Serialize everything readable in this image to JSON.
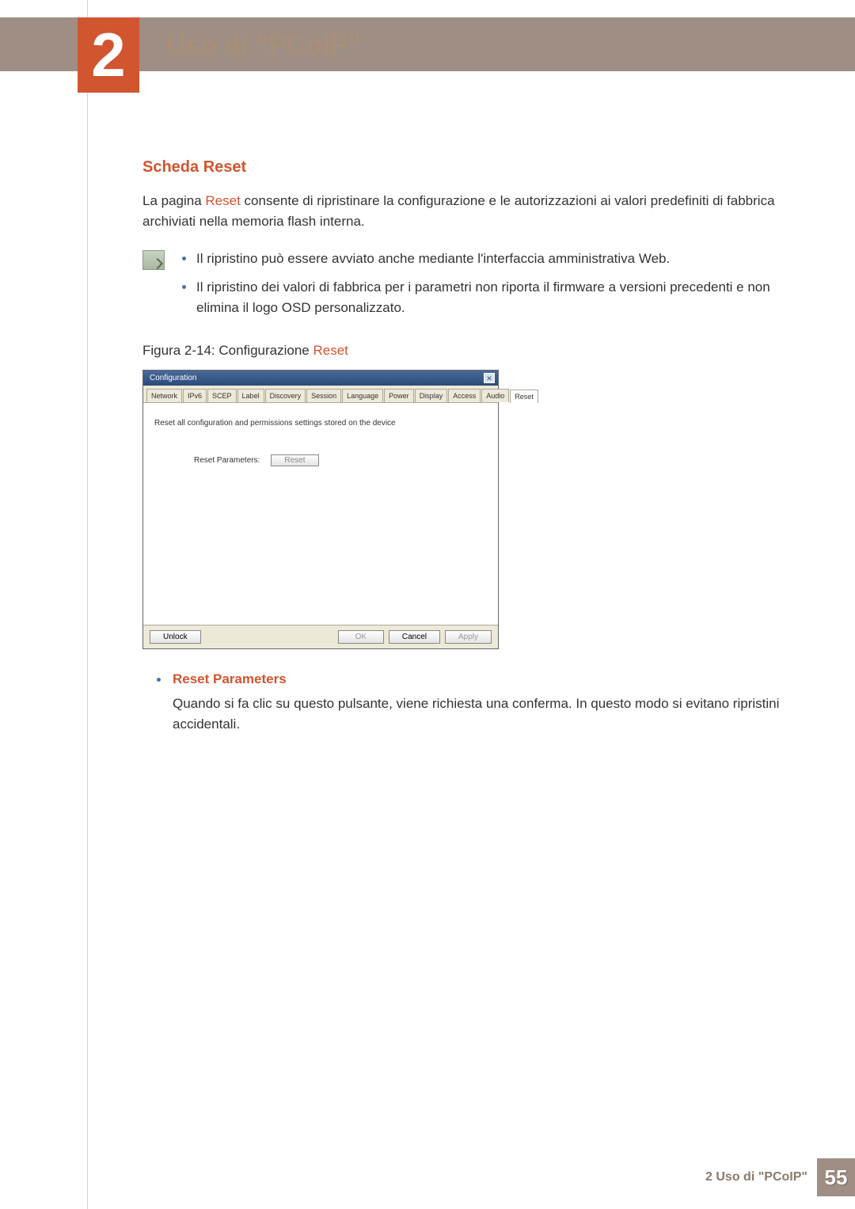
{
  "header": {
    "chapter_number": "2",
    "chapter_title": "Uso di \"PCoIP\""
  },
  "section": {
    "heading": "Scheda Reset",
    "para_prefix": "La pagina ",
    "para_key": "Reset",
    "para_suffix": " consente di ripristinare la configurazione e le autorizzazioni ai valori predefiniti di fabbrica archiviati nella memoria flash interna.",
    "notes": [
      "Il ripristino può essere avviato anche mediante l'interfaccia amministrativa Web.",
      "Il ripristino dei valori di fabbrica per i parametri non riporta il firmware a versioni precedenti e non elimina il logo OSD personalizzato."
    ],
    "figure_caption_prefix": "Figura 2-14: Configurazione ",
    "figure_caption_key": "Reset"
  },
  "dialog": {
    "title": "Configuration",
    "close_glyph": "✕",
    "tabs": [
      "Network",
      "IPv6",
      "SCEP",
      "Label",
      "Discovery",
      "Session",
      "Language",
      "Power",
      "Display",
      "Access",
      "Audio",
      "Reset"
    ],
    "active_tab_index": 11,
    "body_desc": "Reset all configuration and permissions settings stored on the device",
    "reset_label": "Reset Parameters:",
    "reset_button": "Reset",
    "footer": {
      "unlock": "Unlock",
      "ok": "OK",
      "cancel": "Cancel",
      "apply": "Apply"
    }
  },
  "definition": {
    "term": "Reset Parameters",
    "desc": "Quando si fa clic su questo pulsante, viene richiesta una conferma. In questo modo si evitano ripristini accidentali."
  },
  "footer": {
    "text": "2 Uso di \"PCoIP\"",
    "page": "55"
  }
}
